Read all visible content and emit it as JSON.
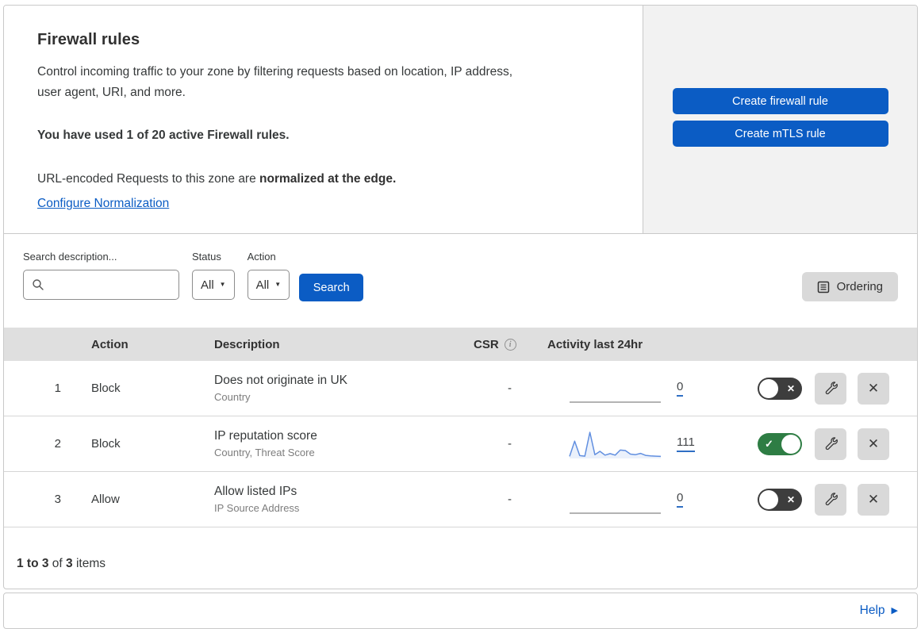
{
  "intro": {
    "title": "Firewall rules",
    "description_line1": "Control incoming traffic to your zone by filtering requests based on location, IP address,",
    "description_line2": "user agent, URI, and more.",
    "usage_bold": "You have used 1 of 20 active Firewall rules.",
    "normalization_prefix": "URL-encoded Requests to this zone are ",
    "normalization_bold": "normalized at the edge.",
    "normalization_link": "Configure Normalization"
  },
  "actions": {
    "create_firewall_rule": "Create firewall rule",
    "create_mtls_rule": "Create mTLS rule"
  },
  "toolbar": {
    "search_label": "Search description...",
    "search_value": "",
    "status_label": "Status",
    "status_value": "All",
    "action_label": "Action",
    "action_value": "All",
    "search_button": "Search",
    "ordering_button": "Ordering"
  },
  "table": {
    "headers": {
      "action": "Action",
      "description": "Description",
      "csr": "CSR",
      "activity": "Activity last 24hr"
    },
    "rows": [
      {
        "number": "1",
        "action": "Block",
        "description": "Does not originate in UK",
        "fields": "Country",
        "csr": "-",
        "activity_count": "0",
        "enabled": false,
        "sparkline": []
      },
      {
        "number": "2",
        "action": "Block",
        "description": "IP reputation score",
        "fields": "Country, Threat Score",
        "csr": "-",
        "activity_count": "111",
        "enabled": true,
        "sparkline": [
          5,
          65,
          8,
          6,
          100,
          12,
          25,
          10,
          16,
          10,
          30,
          28,
          14,
          12,
          17,
          9,
          7,
          6,
          5
        ]
      },
      {
        "number": "3",
        "action": "Allow",
        "description": "Allow listed IPs",
        "fields": "IP Source Address",
        "csr": "-",
        "activity_count": "0",
        "enabled": false,
        "sparkline": []
      }
    ]
  },
  "pagination": {
    "range_bold": "1 to 3",
    "of_text": " of ",
    "total_bold": "3",
    "items_text": " items"
  },
  "footer": {
    "help_label": "Help"
  },
  "colors": {
    "accent_blue": "#0b5cc4",
    "toggle_on_green": "#2e7d44",
    "toggle_off_gray": "#3d3d3d",
    "sparkline_blue": "#618fe0",
    "table_header_gray": "#dfdfdf",
    "panel_gray": "#f2f2f2"
  }
}
